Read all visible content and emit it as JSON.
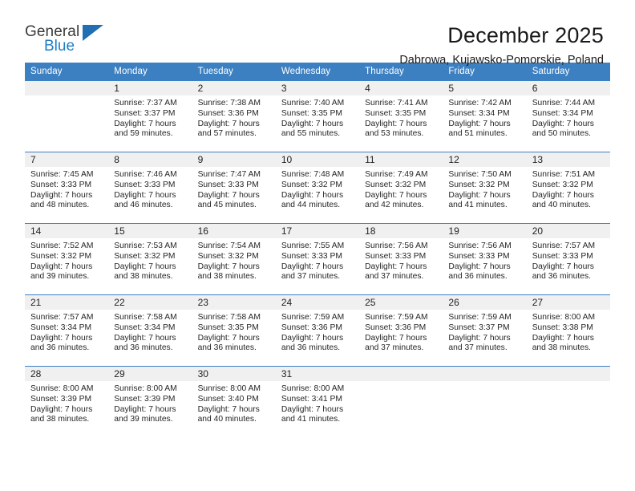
{
  "logo": {
    "line1": "General",
    "line2": "Blue",
    "triangle_icon": "blue-triangle-icon",
    "colors": {
      "text": "#3a3a3a",
      "accent": "#1f7ec4"
    }
  },
  "header": {
    "title": "December 2025",
    "subtitle": "Dabrowa, Kujawsko-Pomorskie, Poland"
  },
  "theme": {
    "header_blue": "#3d80c2",
    "daynum_band": "#f0f0f0",
    "text": "#222222"
  },
  "weekday_headers": [
    "Sunday",
    "Monday",
    "Tuesday",
    "Wednesday",
    "Thursday",
    "Friday",
    "Saturday"
  ],
  "weeks": [
    [
      {
        "day": "",
        "sunrise": "",
        "sunset": "",
        "daylight1": "",
        "daylight2": ""
      },
      {
        "day": "1",
        "sunrise": "Sunrise: 7:37 AM",
        "sunset": "Sunset: 3:37 PM",
        "daylight1": "Daylight: 7 hours",
        "daylight2": "and 59 minutes."
      },
      {
        "day": "2",
        "sunrise": "Sunrise: 7:38 AM",
        "sunset": "Sunset: 3:36 PM",
        "daylight1": "Daylight: 7 hours",
        "daylight2": "and 57 minutes."
      },
      {
        "day": "3",
        "sunrise": "Sunrise: 7:40 AM",
        "sunset": "Sunset: 3:35 PM",
        "daylight1": "Daylight: 7 hours",
        "daylight2": "and 55 minutes."
      },
      {
        "day": "4",
        "sunrise": "Sunrise: 7:41 AM",
        "sunset": "Sunset: 3:35 PM",
        "daylight1": "Daylight: 7 hours",
        "daylight2": "and 53 minutes."
      },
      {
        "day": "5",
        "sunrise": "Sunrise: 7:42 AM",
        "sunset": "Sunset: 3:34 PM",
        "daylight1": "Daylight: 7 hours",
        "daylight2": "and 51 minutes."
      },
      {
        "day": "6",
        "sunrise": "Sunrise: 7:44 AM",
        "sunset": "Sunset: 3:34 PM",
        "daylight1": "Daylight: 7 hours",
        "daylight2": "and 50 minutes."
      }
    ],
    [
      {
        "day": "7",
        "sunrise": "Sunrise: 7:45 AM",
        "sunset": "Sunset: 3:33 PM",
        "daylight1": "Daylight: 7 hours",
        "daylight2": "and 48 minutes."
      },
      {
        "day": "8",
        "sunrise": "Sunrise: 7:46 AM",
        "sunset": "Sunset: 3:33 PM",
        "daylight1": "Daylight: 7 hours",
        "daylight2": "and 46 minutes."
      },
      {
        "day": "9",
        "sunrise": "Sunrise: 7:47 AM",
        "sunset": "Sunset: 3:33 PM",
        "daylight1": "Daylight: 7 hours",
        "daylight2": "and 45 minutes."
      },
      {
        "day": "10",
        "sunrise": "Sunrise: 7:48 AM",
        "sunset": "Sunset: 3:32 PM",
        "daylight1": "Daylight: 7 hours",
        "daylight2": "and 44 minutes."
      },
      {
        "day": "11",
        "sunrise": "Sunrise: 7:49 AM",
        "sunset": "Sunset: 3:32 PM",
        "daylight1": "Daylight: 7 hours",
        "daylight2": "and 42 minutes."
      },
      {
        "day": "12",
        "sunrise": "Sunrise: 7:50 AM",
        "sunset": "Sunset: 3:32 PM",
        "daylight1": "Daylight: 7 hours",
        "daylight2": "and 41 minutes."
      },
      {
        "day": "13",
        "sunrise": "Sunrise: 7:51 AM",
        "sunset": "Sunset: 3:32 PM",
        "daylight1": "Daylight: 7 hours",
        "daylight2": "and 40 minutes."
      }
    ],
    [
      {
        "day": "14",
        "sunrise": "Sunrise: 7:52 AM",
        "sunset": "Sunset: 3:32 PM",
        "daylight1": "Daylight: 7 hours",
        "daylight2": "and 39 minutes."
      },
      {
        "day": "15",
        "sunrise": "Sunrise: 7:53 AM",
        "sunset": "Sunset: 3:32 PM",
        "daylight1": "Daylight: 7 hours",
        "daylight2": "and 38 minutes."
      },
      {
        "day": "16",
        "sunrise": "Sunrise: 7:54 AM",
        "sunset": "Sunset: 3:32 PM",
        "daylight1": "Daylight: 7 hours",
        "daylight2": "and 38 minutes."
      },
      {
        "day": "17",
        "sunrise": "Sunrise: 7:55 AM",
        "sunset": "Sunset: 3:33 PM",
        "daylight1": "Daylight: 7 hours",
        "daylight2": "and 37 minutes."
      },
      {
        "day": "18",
        "sunrise": "Sunrise: 7:56 AM",
        "sunset": "Sunset: 3:33 PM",
        "daylight1": "Daylight: 7 hours",
        "daylight2": "and 37 minutes."
      },
      {
        "day": "19",
        "sunrise": "Sunrise: 7:56 AM",
        "sunset": "Sunset: 3:33 PM",
        "daylight1": "Daylight: 7 hours",
        "daylight2": "and 36 minutes."
      },
      {
        "day": "20",
        "sunrise": "Sunrise: 7:57 AM",
        "sunset": "Sunset: 3:33 PM",
        "daylight1": "Daylight: 7 hours",
        "daylight2": "and 36 minutes."
      }
    ],
    [
      {
        "day": "21",
        "sunrise": "Sunrise: 7:57 AM",
        "sunset": "Sunset: 3:34 PM",
        "daylight1": "Daylight: 7 hours",
        "daylight2": "and 36 minutes."
      },
      {
        "day": "22",
        "sunrise": "Sunrise: 7:58 AM",
        "sunset": "Sunset: 3:34 PM",
        "daylight1": "Daylight: 7 hours",
        "daylight2": "and 36 minutes."
      },
      {
        "day": "23",
        "sunrise": "Sunrise: 7:58 AM",
        "sunset": "Sunset: 3:35 PM",
        "daylight1": "Daylight: 7 hours",
        "daylight2": "and 36 minutes."
      },
      {
        "day": "24",
        "sunrise": "Sunrise: 7:59 AM",
        "sunset": "Sunset: 3:36 PM",
        "daylight1": "Daylight: 7 hours",
        "daylight2": "and 36 minutes."
      },
      {
        "day": "25",
        "sunrise": "Sunrise: 7:59 AM",
        "sunset": "Sunset: 3:36 PM",
        "daylight1": "Daylight: 7 hours",
        "daylight2": "and 37 minutes."
      },
      {
        "day": "26",
        "sunrise": "Sunrise: 7:59 AM",
        "sunset": "Sunset: 3:37 PM",
        "daylight1": "Daylight: 7 hours",
        "daylight2": "and 37 minutes."
      },
      {
        "day": "27",
        "sunrise": "Sunrise: 8:00 AM",
        "sunset": "Sunset: 3:38 PM",
        "daylight1": "Daylight: 7 hours",
        "daylight2": "and 38 minutes."
      }
    ],
    [
      {
        "day": "28",
        "sunrise": "Sunrise: 8:00 AM",
        "sunset": "Sunset: 3:39 PM",
        "daylight1": "Daylight: 7 hours",
        "daylight2": "and 38 minutes."
      },
      {
        "day": "29",
        "sunrise": "Sunrise: 8:00 AM",
        "sunset": "Sunset: 3:39 PM",
        "daylight1": "Daylight: 7 hours",
        "daylight2": "and 39 minutes."
      },
      {
        "day": "30",
        "sunrise": "Sunrise: 8:00 AM",
        "sunset": "Sunset: 3:40 PM",
        "daylight1": "Daylight: 7 hours",
        "daylight2": "and 40 minutes."
      },
      {
        "day": "31",
        "sunrise": "Sunrise: 8:00 AM",
        "sunset": "Sunset: 3:41 PM",
        "daylight1": "Daylight: 7 hours",
        "daylight2": "and 41 minutes."
      },
      {
        "day": "",
        "sunrise": "",
        "sunset": "",
        "daylight1": "",
        "daylight2": ""
      },
      {
        "day": "",
        "sunrise": "",
        "sunset": "",
        "daylight1": "",
        "daylight2": ""
      },
      {
        "day": "",
        "sunrise": "",
        "sunset": "",
        "daylight1": "",
        "daylight2": ""
      }
    ]
  ]
}
